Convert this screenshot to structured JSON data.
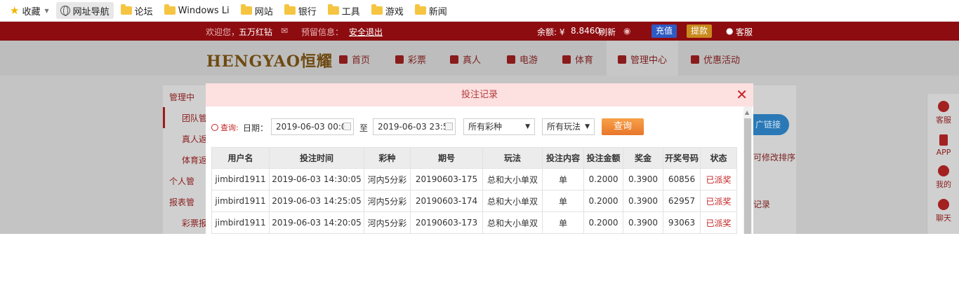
{
  "bookmarks": {
    "favorites_label": "收藏",
    "items": [
      {
        "label": "网址导航",
        "icon": "globe-icon",
        "active": true
      },
      {
        "label": "论坛",
        "icon": "folder-icon"
      },
      {
        "label": "Windows Li",
        "icon": "folder-icon"
      },
      {
        "label": "网站",
        "icon": "folder-icon"
      },
      {
        "label": "银行",
        "icon": "folder-icon"
      },
      {
        "label": "工具",
        "icon": "folder-icon"
      },
      {
        "label": "游戏",
        "icon": "folder-icon"
      },
      {
        "label": "新闻",
        "icon": "folder-icon"
      }
    ]
  },
  "topbar": {
    "welcome": "欢迎您，",
    "username": "五万红钻",
    "notice_label": "预留信息：",
    "logout": "安全退出",
    "balance_label": "余额: ¥",
    "balance": "8.8460",
    "refresh": "刷新",
    "deposit": "充值",
    "withdraw": "提款",
    "service": "客服",
    "colors": {
      "bg": "#8d0c10",
      "deposit": "#2e5ac4",
      "withdraw": "#c98a1c"
    }
  },
  "nav": {
    "logo": "HENGYAO恒耀",
    "items": [
      "首页",
      "彩票",
      "真人",
      "电游",
      "体育",
      "管理中心",
      "优惠活动"
    ]
  },
  "sidebar": {
    "items": [
      "管理中",
      "团队管",
      "真人返",
      "体育返",
      "个人管",
      "报表管",
      "彩票报"
    ]
  },
  "right_card": {
    "button": "广链接",
    "text1": "可修改排序",
    "text2": "记录"
  },
  "right_panel": {
    "items": [
      "客服",
      "APP",
      "我的",
      "聊天"
    ]
  },
  "modal": {
    "title": "投注记录",
    "close": "✕",
    "filter": {
      "query_label": "查询:",
      "date_label": "日期：",
      "start_date": "2019-06-03 00:0",
      "to_label": "至",
      "end_date": "2019-06-03 23:5",
      "lottery_select": "所有彩种",
      "play_select": "所有玩法",
      "search_button": "查询"
    },
    "table": {
      "headers": [
        "用户名",
        "投注时间",
        "彩种",
        "期号",
        "玩法",
        "投注内容",
        "投注金额",
        "奖金",
        "开奖号码",
        "状态"
      ],
      "rows": [
        [
          "jimbird1911",
          "2019-06-03 14:30:05",
          "河内5分彩",
          "20190603-175",
          "总和大小单双",
          "单",
          "0.2000",
          "0.3900",
          "60856",
          "已派奖"
        ],
        [
          "jimbird1911",
          "2019-06-03 14:25:05",
          "河内5分彩",
          "20190603-174",
          "总和大小单双",
          "单",
          "0.2000",
          "0.3900",
          "62957",
          "已派奖"
        ],
        [
          "jimbird1911",
          "2019-06-03 14:20:05",
          "河内5分彩",
          "20190603-173",
          "总和大小单双",
          "单",
          "0.2000",
          "0.3900",
          "93063",
          "已派奖"
        ]
      ]
    }
  }
}
